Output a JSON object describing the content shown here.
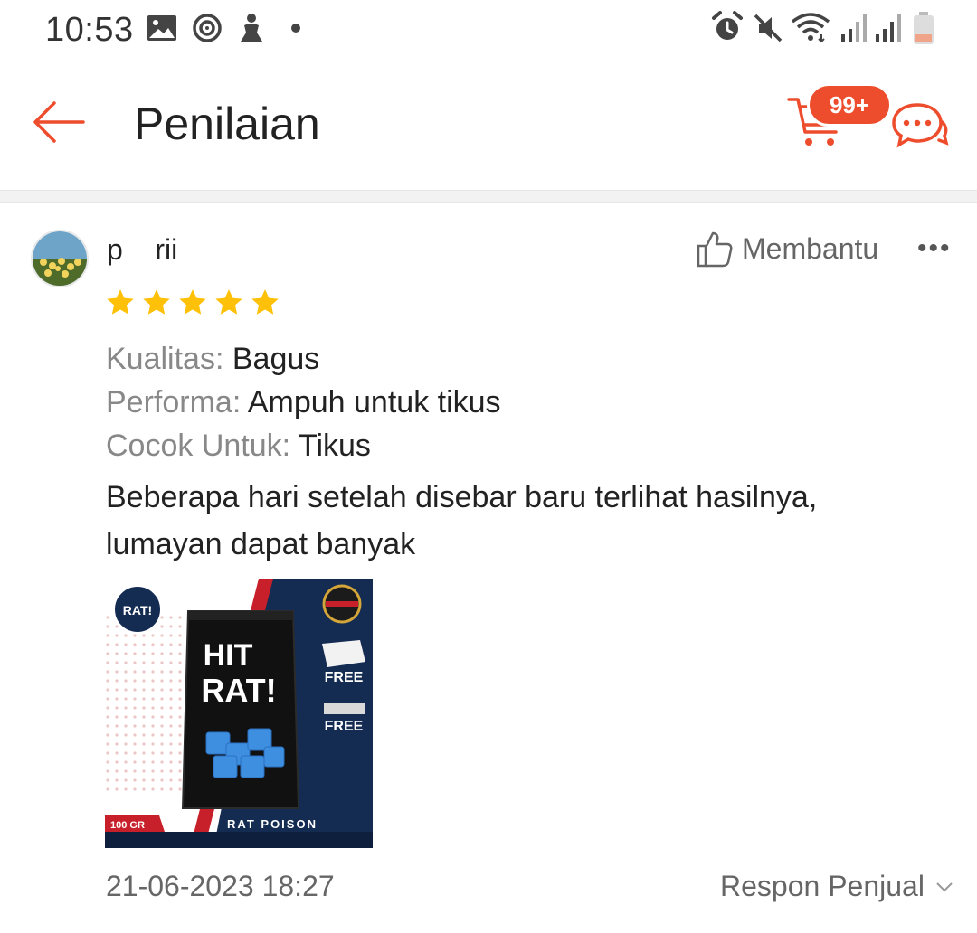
{
  "status_bar": {
    "time": "10:53",
    "icons": [
      "image-icon",
      "sync-icon",
      "figure-icon",
      "dot-icon",
      "alarm-icon",
      "mute-icon",
      "wifi-icon",
      "signal-icon",
      "signal-icon",
      "battery-icon"
    ]
  },
  "header": {
    "title": "Penilaian",
    "cart_badge": "99+",
    "accent_color": "#ee4d2d"
  },
  "review": {
    "username": "p    rii",
    "helpful_label": "Membantu",
    "rating": 5,
    "max_rating": 5,
    "star_color": "#ffc107",
    "attributes": [
      {
        "key": "Kualitas:",
        "value": "Bagus"
      },
      {
        "key": "Performa:",
        "value": "Ampuh untuk tikus"
      },
      {
        "key": "Cocok Untuk:",
        "value": "Tikus"
      }
    ],
    "text_line1": "Beberapa hari setelah disebar baru terlihat hasilnya,",
    "text_line2": "lumayan dapat banyak",
    "product_image": {
      "brand_line1": "HIT",
      "brand_line2": "RAT!",
      "free1": "FREE",
      "free2": "FREE",
      "weight": "100 GR",
      "caption": "RAT POISON"
    },
    "date": "21-06-2023 18:27",
    "seller_response_label": "Respon Penjual"
  }
}
